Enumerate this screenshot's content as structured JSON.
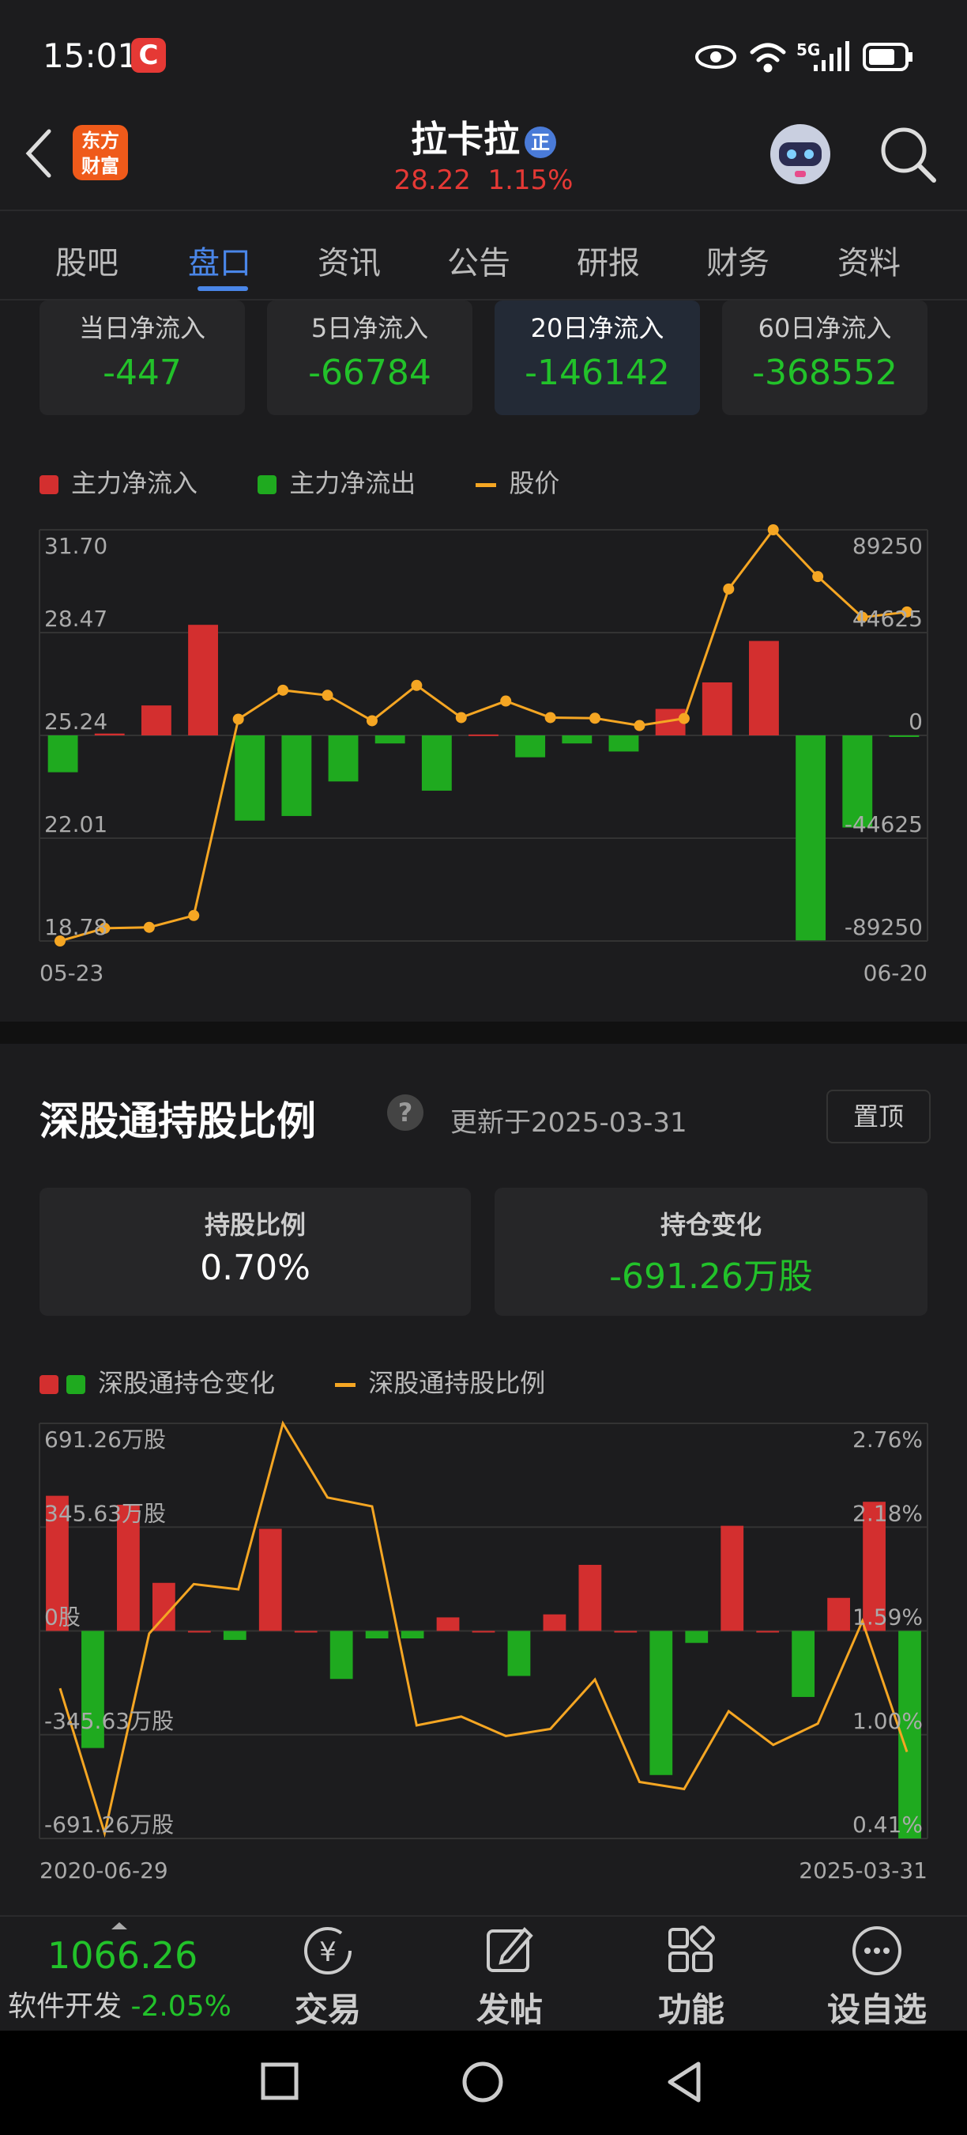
{
  "status": {
    "time": "15:01",
    "network": "5G"
  },
  "header": {
    "logo_text": "东方财富",
    "stock_name": "拉卡拉",
    "badge": "正",
    "price": "28.22",
    "change_pct": "1.15%"
  },
  "tabs": [
    "股吧",
    "盘口",
    "资讯",
    "公告",
    "研报",
    "财务",
    "资料"
  ],
  "active_tab": "盘口",
  "flow_cards": [
    {
      "label": "当日净流入",
      "value": "-447"
    },
    {
      "label": "5日净流入",
      "value": "-66784"
    },
    {
      "label": "20日净流入",
      "value": "-146142"
    },
    {
      "label": "60日净流入",
      "value": "-368552"
    }
  ],
  "flow_legend": {
    "inflow": "主力净流入",
    "outflow": "主力净流出",
    "price": "股价"
  },
  "colors": {
    "red": "#d32f2f",
    "green": "#1faa1f",
    "orange": "#f5a623",
    "blue": "#4a86e8"
  },
  "chart_data": [
    {
      "type": "bar",
      "title": "",
      "left_ticks": [
        "31.70",
        "28.47",
        "25.24",
        "22.01",
        "18.78"
      ],
      "right_ticks": [
        "89250",
        "44625",
        "0",
        "-44625",
        "-89250"
      ],
      "x_start": "05-23",
      "x_end": "06-20",
      "ylim_left": [
        18.78,
        31.7
      ],
      "ylim_right": [
        -89250,
        89250
      ],
      "series": [
        {
          "name": "主力净流入/净流出",
          "values": [
            -16000,
            800,
            13000,
            48000,
            -37000,
            -35000,
            -20000,
            -3500,
            -24000,
            400,
            -9500,
            -3500,
            -7000,
            11500,
            23000,
            41000,
            -89000,
            -40000,
            -447
          ]
        },
        {
          "name": "股价",
          "values": [
            18.78,
            19.18,
            19.21,
            19.58,
            25.75,
            26.66,
            26.5,
            25.7,
            26.81,
            25.8,
            26.32,
            25.8,
            25.78,
            25.55,
            25.77,
            29.84,
            31.7,
            30.23,
            28.95,
            29.12
          ]
        }
      ]
    },
    {
      "type": "bar",
      "title": "",
      "left_ticks": [
        "691.26万股",
        "345.63万股",
        "0股",
        "-345.63万股",
        "-691.26万股"
      ],
      "right_ticks": [
        "2.76%",
        "2.18%",
        "1.59%",
        "1.00%",
        "0.41%"
      ],
      "x_start": "2020-06-29",
      "x_end": "2025-03-31",
      "ylim_left": [
        -691.26,
        691.26
      ],
      "ylim_right": [
        0.41,
        2.76
      ],
      "series": [
        {
          "name": "深股通持仓变化",
          "values": [
            450,
            -390,
            420,
            160,
            0,
            -30,
            340,
            0,
            -160,
            -25,
            -25,
            45,
            0,
            -150,
            55,
            220,
            0,
            -480,
            -40,
            350,
            0,
            -220,
            110,
            430,
            -691.26
          ]
        },
        {
          "name": "深股通持股比例",
          "values": [
            1.26,
            0.44,
            1.57,
            1.85,
            1.82,
            2.76,
            2.34,
            2.29,
            1.05,
            1.1,
            0.99,
            1.03,
            1.31,
            0.73,
            0.69,
            1.13,
            0.94,
            1.06,
            1.64,
            0.9
          ]
        }
      ]
    }
  ],
  "hk_section": {
    "title": "深股通持股比例",
    "help": "?",
    "updated": "更新于2025-03-31",
    "pin_button": "置顶",
    "cards": [
      {
        "label": "持股比例",
        "value": "0.70%"
      },
      {
        "label": "持仓变化",
        "value": "-691.26万股"
      }
    ],
    "legend": {
      "change": "深股通持仓变化",
      "ratio": "深股通持股比例"
    }
  },
  "bottom_bar": {
    "index_value": "1066.26",
    "index_name": "软件开发",
    "index_change": "-2.05%",
    "items": [
      {
        "label": "交易",
        "icon": "yen-cycle-icon"
      },
      {
        "label": "发帖",
        "icon": "edit-icon"
      },
      {
        "label": "功能",
        "icon": "grid-icon"
      },
      {
        "label": "设自选",
        "icon": "more-icon"
      }
    ]
  }
}
